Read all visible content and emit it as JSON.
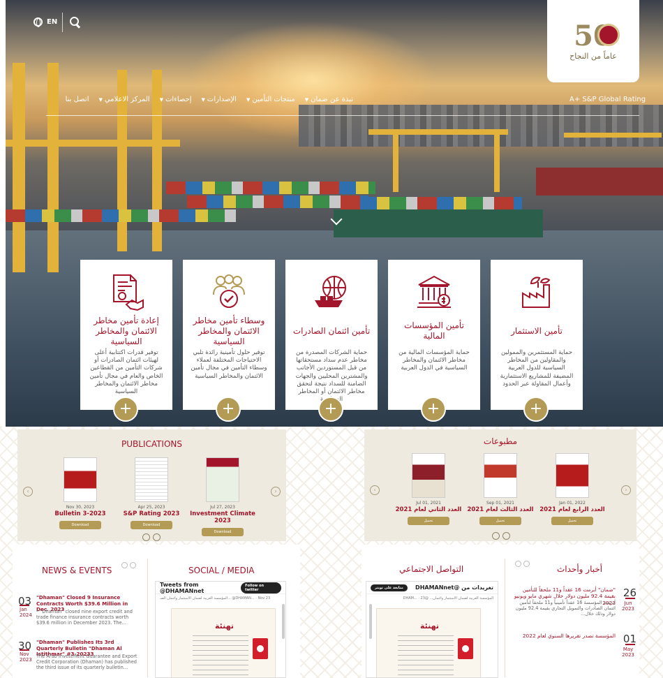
{
  "header": {
    "lang_label": "EN",
    "logo_number": "50",
    "logo_tagline": "عاماً من النجاح",
    "rating": "A+ S&P Global Rating",
    "nav": [
      "نبذة عن ضمان",
      "منتجات التأمين",
      "الإصدارات",
      "إحصاءات",
      "المركز الاعلامي",
      "اتصل بنا"
    ]
  },
  "colors": {
    "brand": "#a3152a",
    "gold": "#b39a55",
    "beige": "#efeadf"
  },
  "cards": [
    {
      "icon": "plant-factory-icon",
      "title": "تأمين الاستثمار",
      "desc": "حماية المستثمرين والممولين والمقاولين من المخاطر السياسية للدول العربية المضيفة للمشاريع الاستثمارية وأعمال المقاولة عبر الحدود"
    },
    {
      "icon": "bank-icon",
      "title": "تأمين المؤسسات المالية",
      "desc": "حماية المؤسسات المالية من مخاطر الائتمان والمخاطر السياسية في الدول العربية"
    },
    {
      "icon": "globe-ship-icon",
      "title": "تأمين ائتمان الصادرات",
      "desc": "حماية الشركات المصدرة من مخاطر عدم سداد مستحقاتها من قبل المستوردين الأجانب والمشترين المحليين والجهات الضامنة للسداد نتيجة لتحقق مخاطر الائتمان أو المخاطر السياسية"
    },
    {
      "icon": "people-check-icon",
      "title": "وسطاء تأمين مخاطر الائتمان والمخاطر السياسية",
      "desc": "توفير حلول تأمينية رائدة تلبي الاحتياجات المختلفة لعملاء وسطاء التأمين في مجال تأمين الائتمان والمخاطر السياسية"
    },
    {
      "icon": "document-handshake-icon",
      "title": "إعادة تأمين مخاطر الائتمان والمخاطر السياسية",
      "desc": "توفير قدرات اكتتابية أعلى لهيئات ائتمان الصادرات أو شركات التأمين من القطاعين الخاص والعام في مجال تأمين مخاطر الائتمان والمخاطر السياسية"
    }
  ],
  "publications_en": {
    "heading": "PUBLICATIONS",
    "items": [
      {
        "date": "Nov 30, 2023",
        "title": "Bulletin 3-2023",
        "button": "Download"
      },
      {
        "date": "Apr 25, 2023",
        "title": "S&P Rating 2023",
        "button": "Download"
      },
      {
        "date": "Jul 27, 2023",
        "title": "Investment Climate 2023",
        "button": "Download"
      }
    ]
  },
  "publications_ar": {
    "heading": "مطبوعات",
    "items": [
      {
        "date": "Jan 01, 2022",
        "title": "العدد الرابع لعام 2021",
        "button": "تحميل"
      },
      {
        "date": "Sep 01, 2021",
        "title": "العدد الثالث لعام 2021",
        "button": "تحميل"
      },
      {
        "date": "Jul 01, 2021",
        "title": "العدد الثاني لعام 2021",
        "button": "تحميل"
      }
    ]
  },
  "news_en": {
    "heading": "NEWS & EVENTS",
    "items": [
      {
        "day": "03",
        "month": "Jan",
        "year": "2024",
        "title": "\"Dhaman\" Closed 9 Insurance Contracts Worth $39.6 Million in Dec. 2023",
        "text": "* \"Dhaman\" closed nine export credit and trade finance insurance contracts worth $39.6 million in December 2023. The..."
      },
      {
        "day": "30",
        "month": "Nov",
        "year": "2023",
        "title": "\"Dhaman\" Publishes Its 3rd Quarterly Bulletin \"Dhaman Al Istithmar\" #3-20233",
        "text": "The Arab Investment Guarantee and Export Credit Corporation (Dhaman) has published the third issue of its quarterly bulletin..."
      }
    ]
  },
  "social_en": {
    "heading": "SOCIAL / MEDIA",
    "feed_title": "Tweets from @DHAMANnet",
    "follow": "Follow on twitter",
    "tweet_meta": "المؤسسة العربية لضمان الاستثمار وائتمان الصـ... @DHAMAN... · Nov 23",
    "card_title": "تهنئة"
  },
  "social_ar": {
    "heading": "التواصل الاجتماعي",
    "feed_title": "تغريدات من @DHAMANnet",
    "follow": "متابعة على تويتر",
    "tweet_meta": "المؤسسة العربية لضمان الاستثمار وائتمان... @DHAM... · 23",
    "card_title": "تهنئة"
  },
  "news_ar": {
    "heading": "أخبار وأحداث",
    "items": [
      {
        "day": "26",
        "month": "Jun",
        "year": "2023",
        "title": "\"ضمان\" أبرمت 16 عقداً و11 ملحقاً للتأمين بقيمة 92.4 مليون دولار خلال شهري مايو ويونيو 2023",
        "text": "أبرمت المؤسسة 16 عقداً تأمينياً و11 ملحقاً لتأمين ائتمان الصادرات والتمويل التجاري بقيمة 92.4 مليون دولار وذلك خلال..."
      },
      {
        "day": "01",
        "month": "May",
        "year": "2023",
        "title": "المؤسسة تصدر تقريرها السنوي لعام 2022",
        "text": ""
      }
    ]
  }
}
